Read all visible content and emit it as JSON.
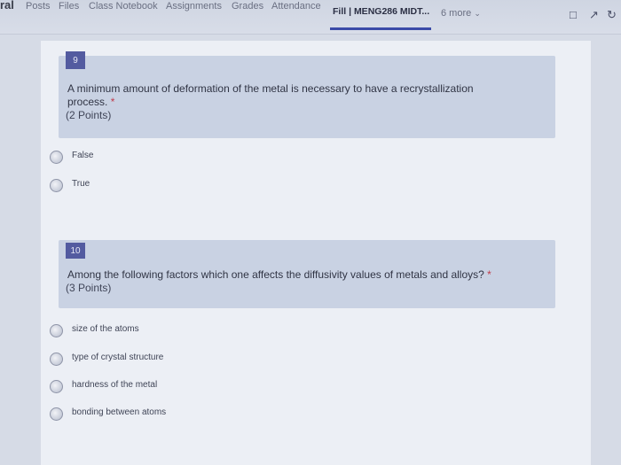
{
  "header": {
    "team": "ral",
    "tabs": [
      "Posts",
      "Files",
      "Class Notebook",
      "Assignments",
      "Grades",
      "Attendance"
    ],
    "active_tab": "Fill | MENG286 MIDT...",
    "more": "6 more"
  },
  "questions": [
    {
      "number": "9",
      "text_line1": "A minimum amount of deformation of the metal is necessary to have a recrystallization",
      "text_line2": "process.",
      "required_mark": "*",
      "points": "(2 Points)",
      "options": [
        "False",
        "True"
      ]
    },
    {
      "number": "10",
      "text_line1": "Among the following factors which one affects the diffusivity values of metals and alloys?",
      "required_mark": "*",
      "points": "(3 Points)",
      "options": [
        "size of the atoms",
        "type of crystal structure",
        "hardness of the metal",
        "bonding between atoms"
      ]
    }
  ],
  "colors": {
    "accent": "#3b4aa8",
    "question_badge": "#535ba0",
    "question_card": "#c9d2e3"
  }
}
